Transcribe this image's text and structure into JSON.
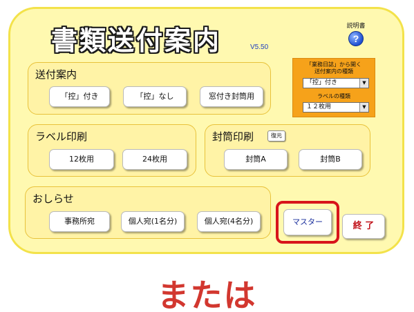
{
  "header": {
    "title": "書類送付案内",
    "version": "V5.50",
    "help_label": "説明書",
    "help_icon": "question-icon"
  },
  "groups": {
    "sofu": {
      "title": "送付案内",
      "buttons": [
        "「控」付き",
        "「控」なし",
        "窓付き封筒用"
      ]
    },
    "label": {
      "title": "ラベル印刷",
      "buttons": [
        "12枚用",
        "24枚用"
      ]
    },
    "futo": {
      "title": "封筒印刷",
      "badge": "復元",
      "buttons": [
        "封筒A",
        "封筒B"
      ]
    },
    "oshirase": {
      "title": "おしらせ",
      "buttons": [
        "事務所宛",
        "個人宛(1名分)",
        "個人宛(4名分)"
      ]
    }
  },
  "settings": {
    "label1_line1": "「業務日誌」から開く",
    "label1_line2": "送付案内の種類",
    "combo1_value": "「控」付き",
    "label2": "ラベルの種類",
    "combo2_value": "１２枚用",
    "arrow": "▼"
  },
  "actions": {
    "master": "マスター",
    "exit": "終 了"
  },
  "caption": "または",
  "colors": {
    "panel_bg": "#fff9b0",
    "panel_border": "#f3e24a",
    "settings_bg": "#f6a21a",
    "highlight": "#d8141b",
    "caption": "#d2372f"
  }
}
